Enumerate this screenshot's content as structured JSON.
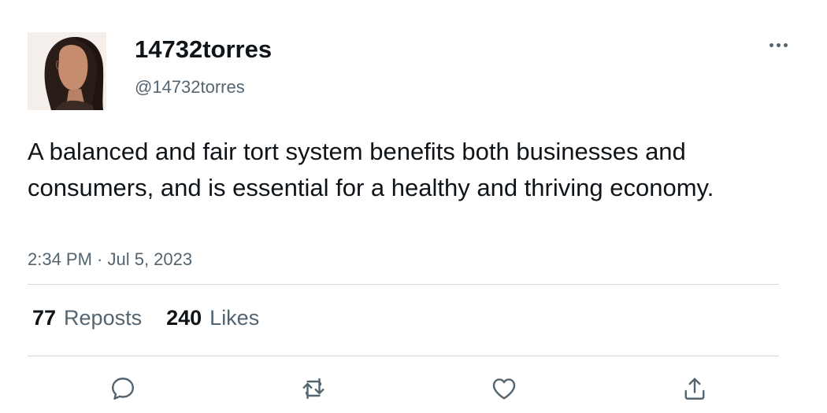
{
  "author": {
    "display_name": "14732torres",
    "handle": "@14732torres",
    "avatar": "profile-photo"
  },
  "tweet": {
    "text": "A balanced and fair tort system benefits both businesses and consumers, and is essential for a healthy and thriving economy.",
    "timestamp": "2:34 PM · Jul 5, 2023"
  },
  "stats": {
    "reposts_count": "77",
    "reposts_label": "Reposts",
    "likes_count": "240",
    "likes_label": "Likes"
  },
  "actions": {
    "reply_icon": "reply-icon",
    "repost_icon": "repost-icon",
    "like_icon": "like-icon",
    "share_icon": "share-icon"
  },
  "colors": {
    "text_primary": "#0f1419",
    "text_secondary": "#536471",
    "divider": "#cfd9de",
    "background": "#ffffff"
  }
}
